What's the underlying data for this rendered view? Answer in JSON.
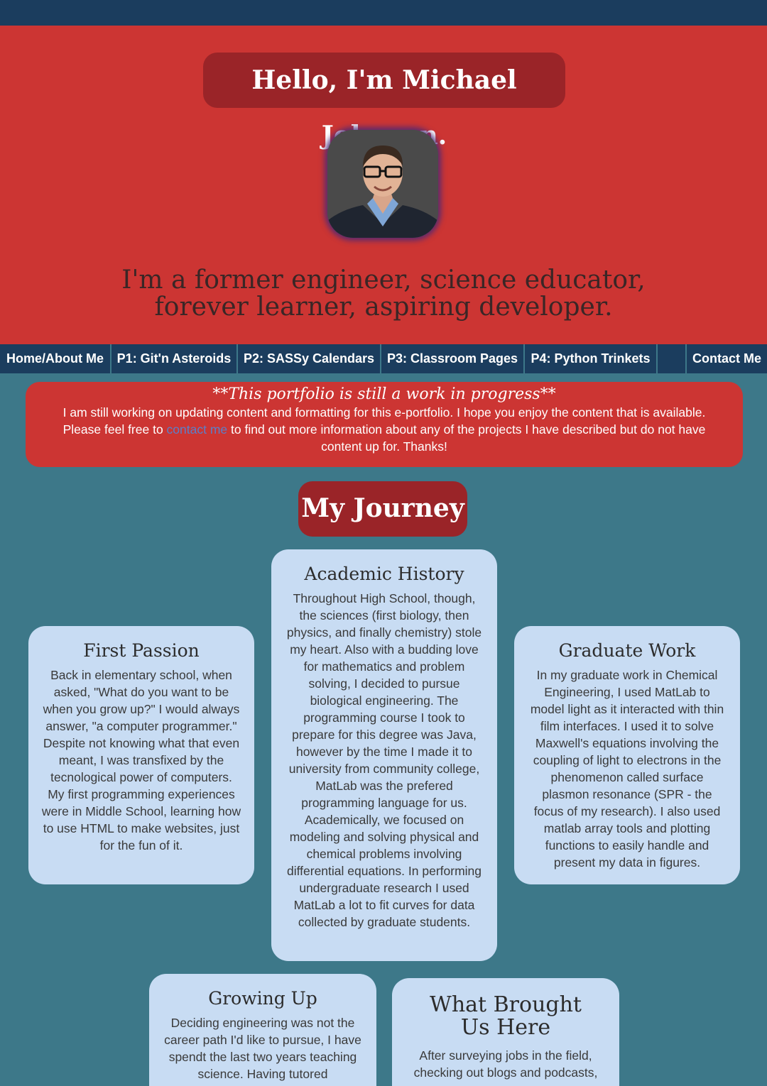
{
  "hero": {
    "title": "Hello, I'm Michael Johnson.",
    "tagline": "I'm a former engineer, science educator, forever learner, aspiring developer."
  },
  "nav": {
    "items": [
      {
        "label": "Home/About Me"
      },
      {
        "label": "P1: Git'n Asteroids"
      },
      {
        "label": "P2: SASSy Calendars"
      },
      {
        "label": "P3: Classroom Pages"
      },
      {
        "label": "P4: Python Trinkets"
      },
      {
        "label": ""
      },
      {
        "label": "Contact Me"
      }
    ]
  },
  "notice": {
    "title": "**This portfolio is still a work in progress**",
    "body_before": "I am still working on updating content and formatting for this e-portfolio. I hope you enjoy the content that is available. Please feel free to ",
    "link": "contact me",
    "body_after": " to find out more information about any of the projects I have described but do not have content up for. Thanks!"
  },
  "journey": {
    "title": "My Journey"
  },
  "cards": {
    "first_passion": {
      "title": "First Passion",
      "body": "Back in elementary school, when asked, \"What do you want to be when you grow up?\" I would always answer, \"a computer programmer.\" Despite not knowing what that even meant, I was transfixed by the tecnological power of computers. My first programming experiences were in Middle School, learning how to use HTML to make websites, just for the fun of it."
    },
    "academic_history": {
      "title": "Academic History",
      "body": "Throughout High School, though, the sciences (first biology, then physics, and finally chemistry) stole my heart. Also with a budding love for mathematics and problem solving, I decided to pursue biological engineering. The programming course I took to prepare for this degree was Java, however by the time I made it to university from community college, MatLab was the prefered programming language for us. Academically, we focused on modeling and solving physical and chemical problems involving differential equations. In performing undergraduate research I used MatLab a lot to fit curves for data collected by graduate students."
    },
    "graduate_work": {
      "title": "Graduate Work",
      "body": "In my graduate work in Chemical Engineering, I used MatLab to model light as it interacted with thin film interfaces. I used it to solve Maxwell's equations involving the coupling of light to electrons in the phenomenon called surface plasmon resonance (SPR - the focus of my research). I also used matlab array tools and plotting functions to easily handle and present my data in figures."
    },
    "growing_up": {
      "title": "Growing Up",
      "body": "Deciding engineering was not the career path I'd like to pursue, I have spendt the last two years teaching science. Having tutored"
    },
    "what_brought": {
      "title": "What Brought Us Here",
      "body": "After surveying jobs in the field, checking out blogs and podcasts,"
    }
  },
  "colors": {
    "topbar": "#1b3d5e",
    "hero": "#cc3533",
    "title_box": "#9a2428",
    "page_bg": "#3d7889",
    "card_bg": "#c8dcf3",
    "link": "#5b7fc8"
  }
}
